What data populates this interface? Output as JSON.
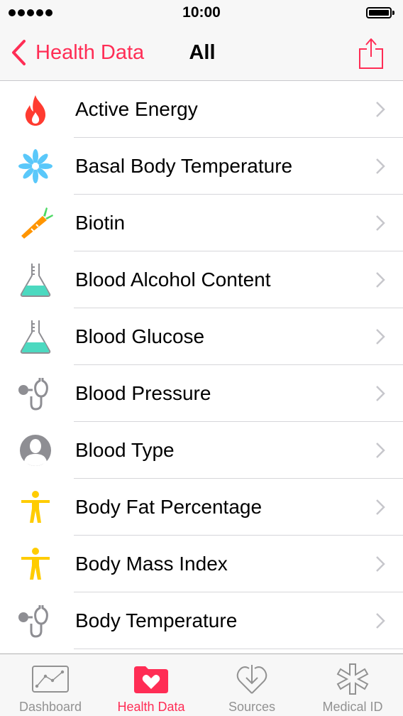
{
  "status_bar": {
    "time": "10:00"
  },
  "nav": {
    "back_label": "Health Data",
    "title": "All"
  },
  "rows": [
    {
      "label": "Active Energy",
      "icon": "flame-icon"
    },
    {
      "label": "Basal Body Temperature",
      "icon": "snowflake-icon"
    },
    {
      "label": "Biotin",
      "icon": "carrot-icon"
    },
    {
      "label": "Blood Alcohol Content",
      "icon": "flask-icon"
    },
    {
      "label": "Blood Glucose",
      "icon": "flask-icon"
    },
    {
      "label": "Blood Pressure",
      "icon": "stethoscope-icon"
    },
    {
      "label": "Blood Type",
      "icon": "person-silhouette-icon"
    },
    {
      "label": "Body Fat Percentage",
      "icon": "body-figure-icon"
    },
    {
      "label": "Body Mass Index",
      "icon": "body-figure-icon"
    },
    {
      "label": "Body Temperature",
      "icon": "stethoscope-icon"
    }
  ],
  "tabs": [
    {
      "label": "Dashboard",
      "icon": "dashboard-icon",
      "active": false
    },
    {
      "label": "Health Data",
      "icon": "health-data-icon",
      "active": true
    },
    {
      "label": "Sources",
      "icon": "sources-icon",
      "active": false
    },
    {
      "label": "Medical ID",
      "icon": "medical-id-icon",
      "active": false
    }
  ],
  "colors": {
    "accent": "#ff2d55",
    "inactive_tab": "#929292",
    "fitness": "#ff3b30",
    "body_measurements": "#ffcc00",
    "nutrition": "#ff9500",
    "lab_results": "#4cd9c0",
    "vitals": "#8e8e93",
    "reproductive": "#5ac8fa"
  }
}
